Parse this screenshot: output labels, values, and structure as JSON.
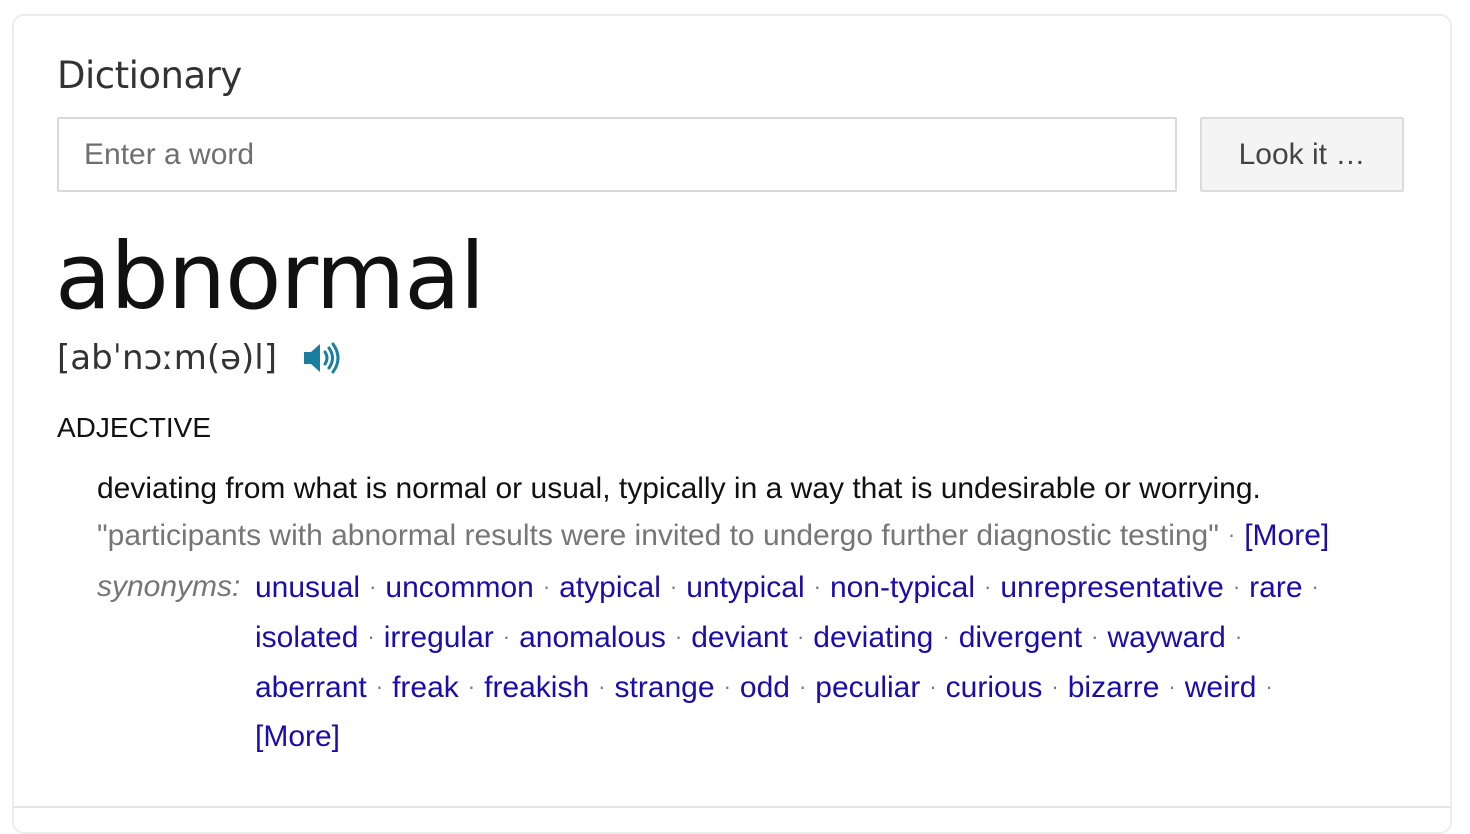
{
  "panel": {
    "title": "Dictionary"
  },
  "search": {
    "placeholder": "Enter a word",
    "value": "",
    "button_label": "Look it …"
  },
  "entry": {
    "word": "abnormal",
    "pronunciation": "[abˈnɔːm(ə)l]",
    "audio_icon": "speaker-icon",
    "part_of_speech": "ADJECTIVE",
    "definition": "deviating from what is normal or usual, typically in a way that is undesirable or worrying.",
    "example": "\"participants with abnormal results were invited to undergo further diagnostic testing\"",
    "example_more_label": "[More]",
    "synonyms_label": "synonyms:",
    "synonym_lines": [
      [
        "unusual",
        "uncommon",
        "atypical",
        "untypical",
        "non-typical",
        "unrepresentative",
        "rare"
      ],
      [
        "isolated",
        "irregular",
        "anomalous",
        "deviant",
        "deviating",
        "divergent",
        "wayward"
      ],
      [
        "aberrant",
        "freak",
        "freakish",
        "strange",
        "odd",
        "peculiar",
        "curious",
        "bizarre",
        "weird"
      ]
    ],
    "synonyms_more_label": "[More]",
    "separator": "·"
  },
  "colors": {
    "link": "#1a0dab",
    "audio_icon": "#1a7f9f",
    "muted": "#767676"
  }
}
